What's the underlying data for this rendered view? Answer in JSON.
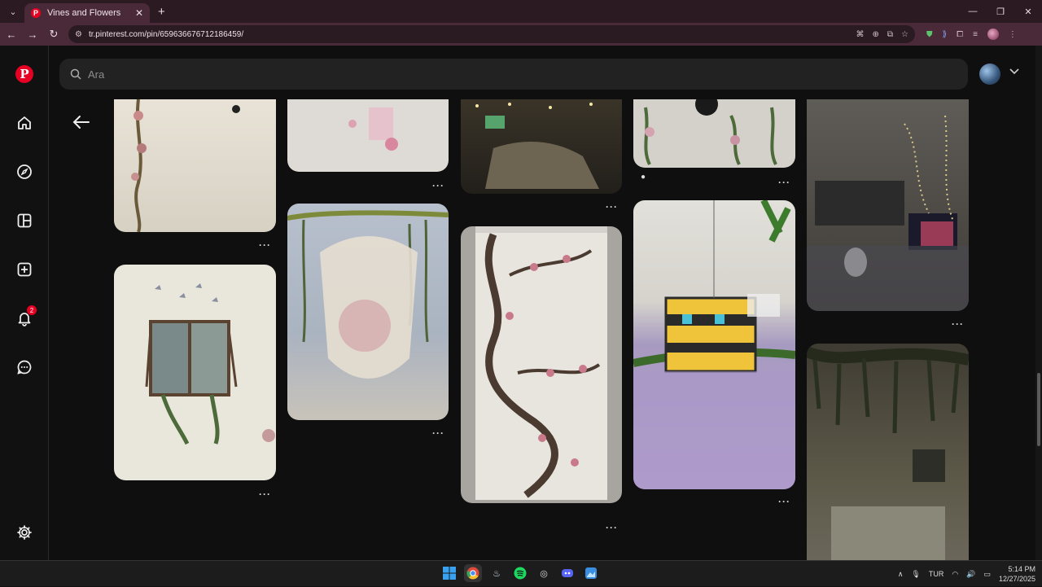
{
  "browser": {
    "tab_title": "Vines and Flowers",
    "url": "tr.pinterest.com/pin/659636676712186459/",
    "accent": "#4a2a38"
  },
  "pinterest": {
    "search_placeholder": "Ara",
    "notification_count": "2",
    "more_label": "···",
    "brand_color": "#e60023"
  },
  "sidebar_icons": [
    "pinterest-logo",
    "home-icon",
    "explore-icon",
    "boards-icon",
    "create-icon",
    "notifications-icon",
    "messages-icon",
    "settings-icon"
  ],
  "taskbar": {
    "language": "TUR",
    "time": "5:14 PM",
    "date": "12/27/2025"
  }
}
